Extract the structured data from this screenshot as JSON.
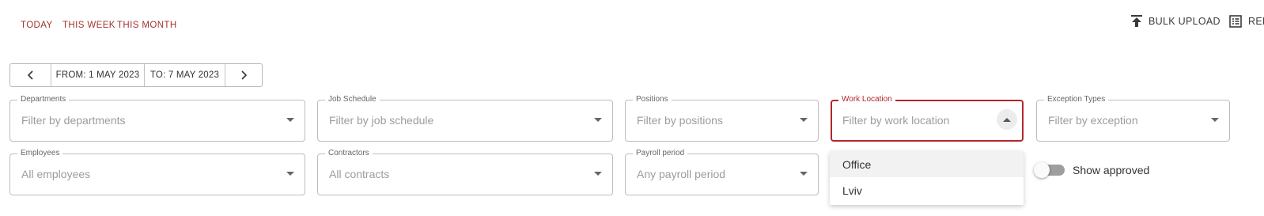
{
  "quick_range": {
    "today": "TODAY",
    "this_week": "THIS WEEK",
    "this_month": "THIS MONTH"
  },
  "actions": {
    "bulk_upload": "BULK UPLOAD",
    "reports": "REPORTS"
  },
  "date_nav": {
    "from": "FROM: 1 MAY 2023",
    "to": "TO: 7 MAY 2023"
  },
  "filters": {
    "departments": {
      "label": "Departments",
      "placeholder": "Filter by departments"
    },
    "job_schedule": {
      "label": "Job Schedule",
      "placeholder": "Filter by job schedule"
    },
    "positions": {
      "label": "Positions",
      "placeholder": "Filter by positions"
    },
    "work_location": {
      "label": "Work Location",
      "placeholder": "Filter by work location"
    },
    "exception_types": {
      "label": "Exception Types",
      "placeholder": "Filter by exception"
    },
    "employees": {
      "label": "Employees",
      "placeholder": "All employees"
    },
    "contractors": {
      "label": "Contractors",
      "placeholder": "All contracts"
    },
    "payroll_period": {
      "label": "Payroll period",
      "placeholder": "Any payroll period"
    }
  },
  "work_location_options": [
    "Office",
    "Lviv"
  ],
  "show_approved": {
    "label": "Show approved",
    "checked": false
  },
  "colors": {
    "accent": "#b3262b",
    "link": "#a23430"
  },
  "icons": {
    "bulk_upload": "upload-icon",
    "reports": "list-report-icon",
    "prev": "chevron-left-icon",
    "next": "chevron-right-icon"
  }
}
